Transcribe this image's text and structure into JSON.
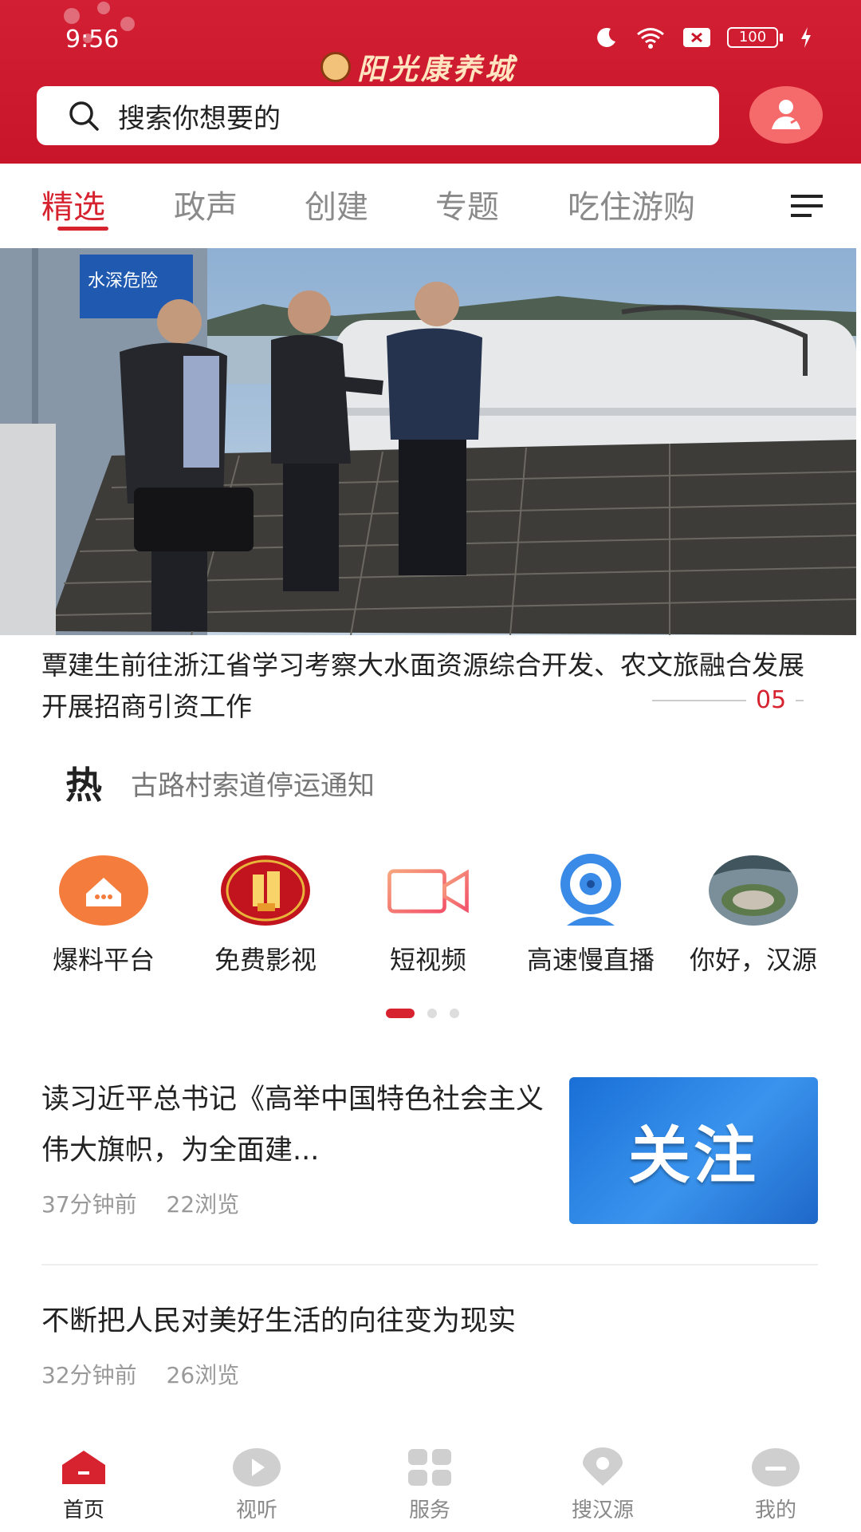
{
  "status_bar": {
    "time": "9:56",
    "battery": "100"
  },
  "header": {
    "brand": "阳光康养城",
    "search_placeholder": "搜索你想要的"
  },
  "tabs": [
    {
      "label": "精选",
      "active": true
    },
    {
      "label": "政声"
    },
    {
      "label": "创建"
    },
    {
      "label": "专题"
    },
    {
      "label": "吃住游购"
    }
  ],
  "banner": {
    "sign_text": "水深危险",
    "caption": "覃建生前往浙江省学习考察大水面资源综合开发、农文旅融合发展 开展招商引资工作",
    "slide_number": "05"
  },
  "hot": {
    "badge": "热",
    "text": "古路村索道停运通知"
  },
  "quick_links": [
    {
      "label": "爆料平台",
      "icon": "house-chat-icon"
    },
    {
      "label": "免费影视",
      "icon": "gift-icon"
    },
    {
      "label": "短视频",
      "icon": "video-camera-icon"
    },
    {
      "label": "高速慢直播",
      "icon": "webcam-icon"
    },
    {
      "label": "你好，汉源",
      "icon": "landscape-thumbnail-icon"
    }
  ],
  "articles": [
    {
      "title": "读习近平总书记《高举中国特色社会主义伟大旗帜，为全面建...",
      "time": "37分钟前",
      "views": "22浏览",
      "thumb_text": "关注"
    },
    {
      "title": "不断把人民对美好生活的向往变为现实",
      "time": "32分钟前",
      "views": "26浏览"
    }
  ],
  "bottom_nav": [
    {
      "label": "首页",
      "icon": "home-icon",
      "active": true
    },
    {
      "label": "视听",
      "icon": "play-icon"
    },
    {
      "label": "服务",
      "icon": "grid-icon"
    },
    {
      "label": "搜汉源",
      "icon": "location-pin-icon"
    },
    {
      "label": "我的",
      "icon": "profile-icon"
    }
  ],
  "colors": {
    "brand_red": "#d6232f",
    "header_red": "#c91529",
    "thumb_blue": "#1a6fd6"
  }
}
